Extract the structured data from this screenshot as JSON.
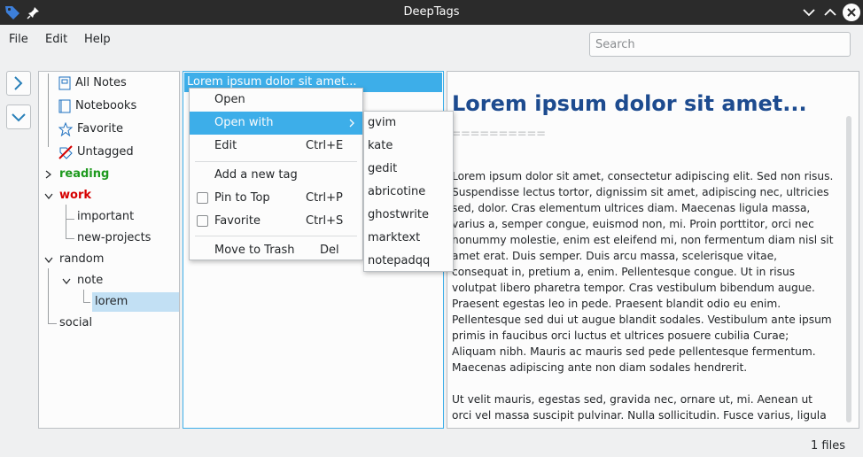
{
  "window": {
    "title": "DeepTags"
  },
  "menubar": {
    "file": "File",
    "edit": "Edit",
    "help": "Help"
  },
  "search": {
    "placeholder": "Search"
  },
  "tree": {
    "all_notes": "All Notes",
    "notebooks": "Notebooks",
    "favorite": "Favorite",
    "untagged": "Untagged",
    "reading": "reading",
    "work": "work",
    "important": "important",
    "new_projects": "new-projects",
    "random": "random",
    "note": "note",
    "lorem": "lorem",
    "social": "social"
  },
  "colors": {
    "accent": "#3daee9",
    "reading": "#1e9a1e",
    "work": "#d60000",
    "heading": "#1d4b8f"
  },
  "list": {
    "items": [
      "Lorem ipsum dolor sit amet..."
    ]
  },
  "context_menu": {
    "open": "Open",
    "open_with": "Open with",
    "edit": "Edit",
    "edit_shortcut": "Ctrl+E",
    "add_tag": "Add a new tag",
    "pin": "Pin to Top",
    "pin_shortcut": "Ctrl+P",
    "favorite": "Favorite",
    "favorite_shortcut": "Ctrl+S",
    "trash": "Move to Trash",
    "trash_shortcut": "Del"
  },
  "submenu": [
    "gvim",
    "kate",
    "gedit",
    "abricotine",
    "ghostwrite",
    "marktext",
    "notepadqq"
  ],
  "preview": {
    "title": "Lorem ipsum dolor sit amet...",
    "underline": "==========",
    "para1": "Lorem ipsum dolor sit amet, consectetur adipiscing elit. Sed non risus. Suspendisse lectus tortor, dignissim sit amet, adipiscing nec, ultricies sed, dolor. Cras elementum ultrices diam. Maecenas ligula massa, varius a, semper congue, euismod non, mi. Proin porttitor, orci nec nonummy molestie, enim est eleifend mi, non fermentum diam nisl sit amet erat. Duis semper. Duis arcu massa, scelerisque vitae, consequat in, pretium a, enim. Pellentesque congue. Ut in risus volutpat libero pharetra tempor. Cras vestibulum bibendum augue. Praesent egestas leo in pede. Praesent blandit odio eu enim. Pellentesque sed dui ut augue blandit sodales. Vestibulum ante ipsum primis in faucibus orci luctus et ultrices posuere cubilia Curae; Aliquam nibh. Mauris ac mauris sed pede pellentesque fermentum. Maecenas adipiscing ante non diam sodales hendrerit.",
    "para2": "Ut velit mauris, egestas sed, gravida nec, ornare ut, mi. Aenean ut orci vel massa suscipit pulvinar. Nulla sollicitudin. Fusce varius, ligula non"
  },
  "status": {
    "files": "1 files"
  }
}
